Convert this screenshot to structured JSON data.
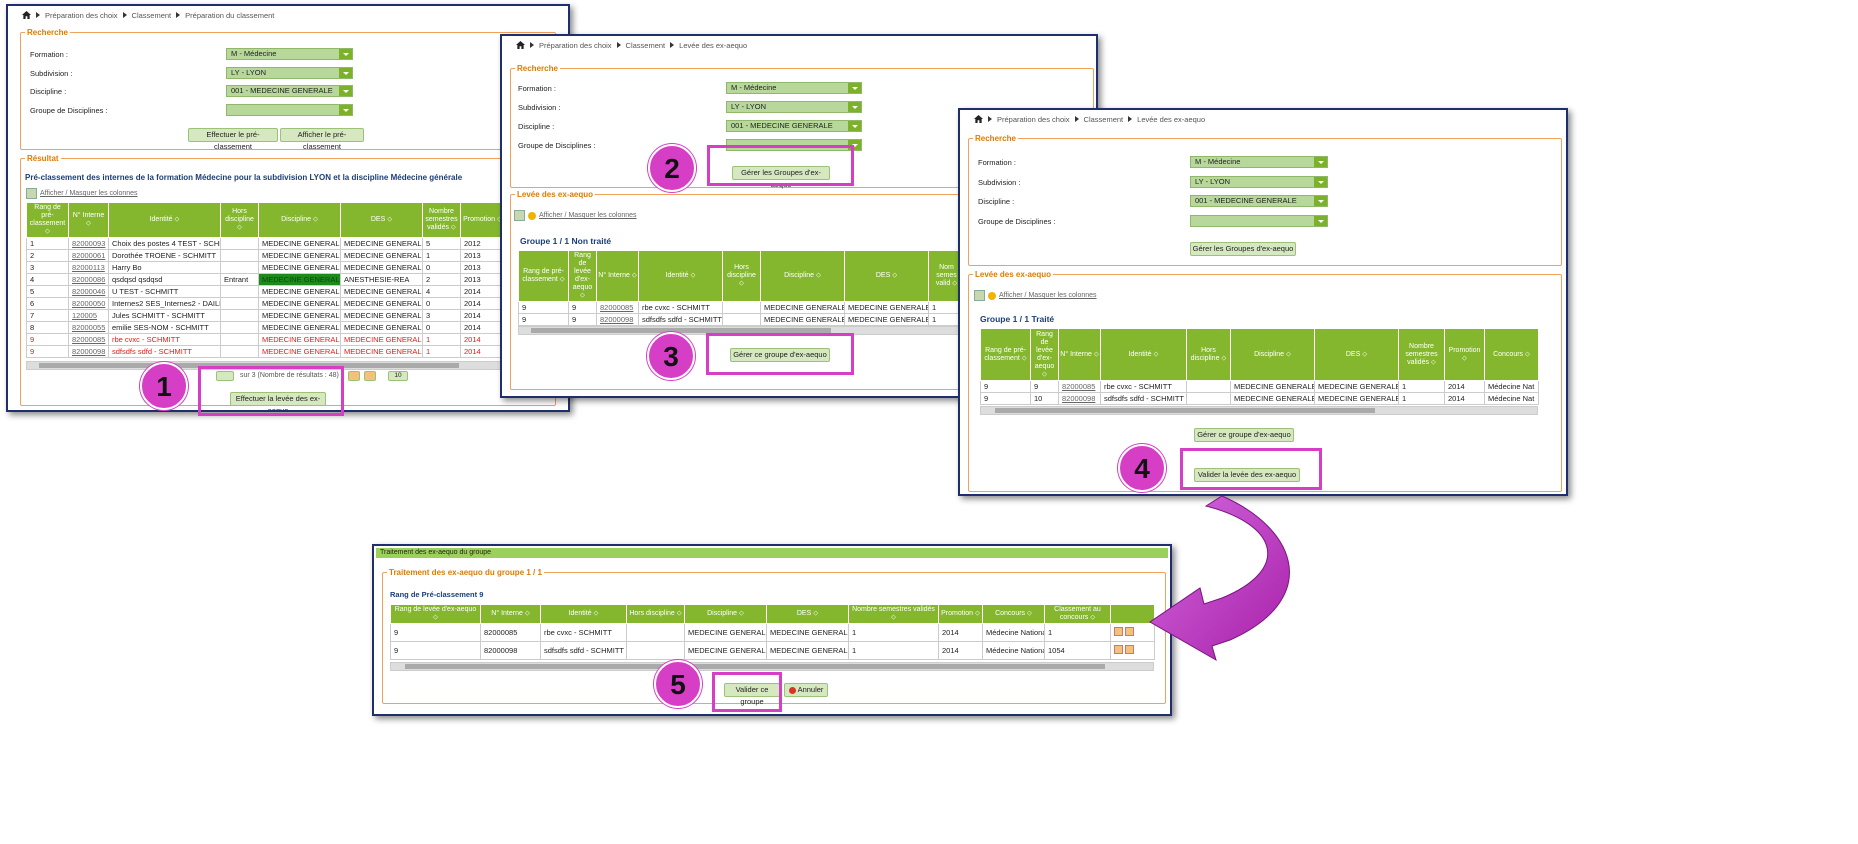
{
  "w1": {
    "crumb": [
      "Préparation des choix",
      "Classement",
      "Préparation du classement"
    ],
    "recherche": "Recherche",
    "labels": [
      "Formation :",
      "Subdivision :",
      "Discipline :",
      "Groupe de Disciplines :"
    ],
    "values": [
      "M - Médecine",
      "LY - LYON",
      "001 - MEDECINE GENERALE",
      ""
    ],
    "btn1": "Effectuer le pré-classement",
    "btn2": "Afficher le pré-classement",
    "resultat": "Résultat",
    "title": "Pré-classement des internes de la formation Médecine pour la subdivision LYON et la discipline Médecine générale",
    "colvis": "Afficher / Masquer les colonnes",
    "headers": [
      "Rang de pré-classement",
      "N° Interne",
      "Identité",
      "Hors discipline",
      "Discipline",
      "DES",
      "Nombre semestres validés",
      "Promotion"
    ],
    "rows": [
      [
        "1",
        "82000093",
        "Choix des postes 4 TEST - SCHMITT",
        "",
        "MEDECINE GENERALE",
        "MEDECINE GENERALE",
        "5",
        "2012"
      ],
      [
        "2",
        "82000061",
        "Dorothée TROENE - SCHMITT",
        "",
        "MEDECINE GENERALE",
        "MEDECINE GENERALE",
        "1",
        "2013"
      ],
      [
        "3",
        "82000113",
        "Harry Bo",
        "",
        "MEDECINE GENERALE",
        "MEDECINE GENERALE",
        "0",
        "2013"
      ],
      [
        "4",
        "82000086",
        "qsdqsd qsdqsd",
        "Entrant",
        "MEDECINE GENERALE",
        "ANESTHESIE-REA",
        "2",
        "2013"
      ],
      [
        "5",
        "82000046",
        "U TEST - SCHMITT",
        "",
        "MEDECINE GENERALE",
        "MEDECINE GENERALE",
        "4",
        "2014"
      ],
      [
        "6",
        "82000050",
        "Internes2 SES_Internes2 - DAILLOU",
        "",
        "MEDECINE GENERALE",
        "MEDECINE GENERALE",
        "0",
        "2014"
      ],
      [
        "7",
        "120005",
        "Jules SCHMITT - SCHMITT",
        "",
        "MEDECINE GENERALE",
        "MEDECINE GENERALE",
        "3",
        "2014"
      ],
      [
        "8",
        "82000055",
        "emilie SES-NOM - SCHMITT",
        "",
        "MEDECINE GENERALE",
        "MEDECINE GENERALE",
        "0",
        "2014"
      ],
      [
        "9",
        "82000085",
        "rbe cvxc - SCHMITT",
        "",
        "MEDECINE GENERALE",
        "MEDECINE GENERALE",
        "1",
        "2014"
      ],
      [
        "9",
        "82000098",
        "sdfsdfs sdfd - SCHMITT",
        "",
        "MEDECINE GENERALE",
        "MEDECINE GENERALE",
        "1",
        "2014"
      ]
    ],
    "pager": "sur 3 (Nombre de résultats : 48)",
    "pagesize": "10",
    "btn3": "Effectuer la levée des ex-aequo"
  },
  "w2": {
    "crumb": [
      "Préparation des choix",
      "Classement",
      "Levée des ex-aequo"
    ],
    "btn_groupes": "Gérer les Groupes d'ex-aequo",
    "levee": "Levée des ex-aequo",
    "group": "Groupe 1 / 1 Non traité",
    "headers": [
      "Rang de pré-classement",
      "Rang de levée d'ex-aequo",
      "N° Interne",
      "Identité",
      "Hors discipline",
      "Discipline",
      "DES",
      "Nom semes valid"
    ],
    "rows": [
      [
        "9",
        "9",
        "82000085",
        "rbe cvxc - SCHMITT",
        "",
        "MEDECINE GENERALE",
        "MEDECINE GENERALE",
        "1"
      ],
      [
        "9",
        "9",
        "82000098",
        "sdfsdfs sdfd - SCHMITT",
        "",
        "MEDECINE GENERALE",
        "MEDECINE GENERALE",
        "1"
      ]
    ],
    "btn_groupe": "Gérer ce groupe d'ex-aequo"
  },
  "w3": {
    "crumb": [
      "Préparation des choix",
      "Classement",
      "Levée des ex-aequo"
    ],
    "group": "Groupe 1 / 1 Traité",
    "headers": [
      "Rang de pré-classement",
      "Rang de levée d'ex-aequo",
      "N° Interne",
      "Identité",
      "Hors discipline",
      "Discipline",
      "DES",
      "Nombre semestres validés",
      "Promotion",
      "Concours"
    ],
    "rows": [
      [
        "9",
        "9",
        "82000085",
        "rbe cvxc - SCHMITT",
        "",
        "MEDECINE GENERALE",
        "MEDECINE GENERALE",
        "1",
        "2014",
        "Médecine Nat"
      ],
      [
        "9",
        "10",
        "82000098",
        "sdfsdfs sdfd - SCHMITT",
        "",
        "MEDECINE GENERALE",
        "MEDECINE GENERALE",
        "1",
        "2014",
        "Médecine Nat"
      ]
    ],
    "btn_valider": "Valider la levée des ex-aequo"
  },
  "w4": {
    "titlebar": "Traitement des ex-aequo du groupe",
    "legend": "Traitement des ex-aequo du groupe 1 / 1",
    "rang": "Rang de Pré-classement 9",
    "headers": [
      "Rang de levée d'ex-aequo",
      "N° Interne",
      "Identité",
      "Hors discipline",
      "Discipline",
      "DES",
      "Nombre semestres validés",
      "Promotion",
      "Concours",
      "Classement au concours",
      ""
    ],
    "rows": [
      [
        "9",
        "82000085",
        "rbe cvxc - SCHMITT",
        "",
        "MEDECINE GENERALE",
        "MEDECINE GENERALE",
        "1",
        "2014",
        "Médecine National",
        "1"
      ],
      [
        "9",
        "82000098",
        "sdfsdfs sdfd - SCHMITT",
        "",
        "MEDECINE GENERALE",
        "MEDECINE GENERALE",
        "1",
        "2014",
        "Médecine National",
        "1054"
      ]
    ],
    "valider": "Valider ce groupe",
    "annuler": "Annuler"
  },
  "steps": [
    "1",
    "2",
    "3",
    "4",
    "5"
  ],
  "colors": {
    "highlight": "#d63ec5",
    "green": "#84b72e",
    "orange": "#e07b00",
    "frame": "#1f2f6e"
  }
}
